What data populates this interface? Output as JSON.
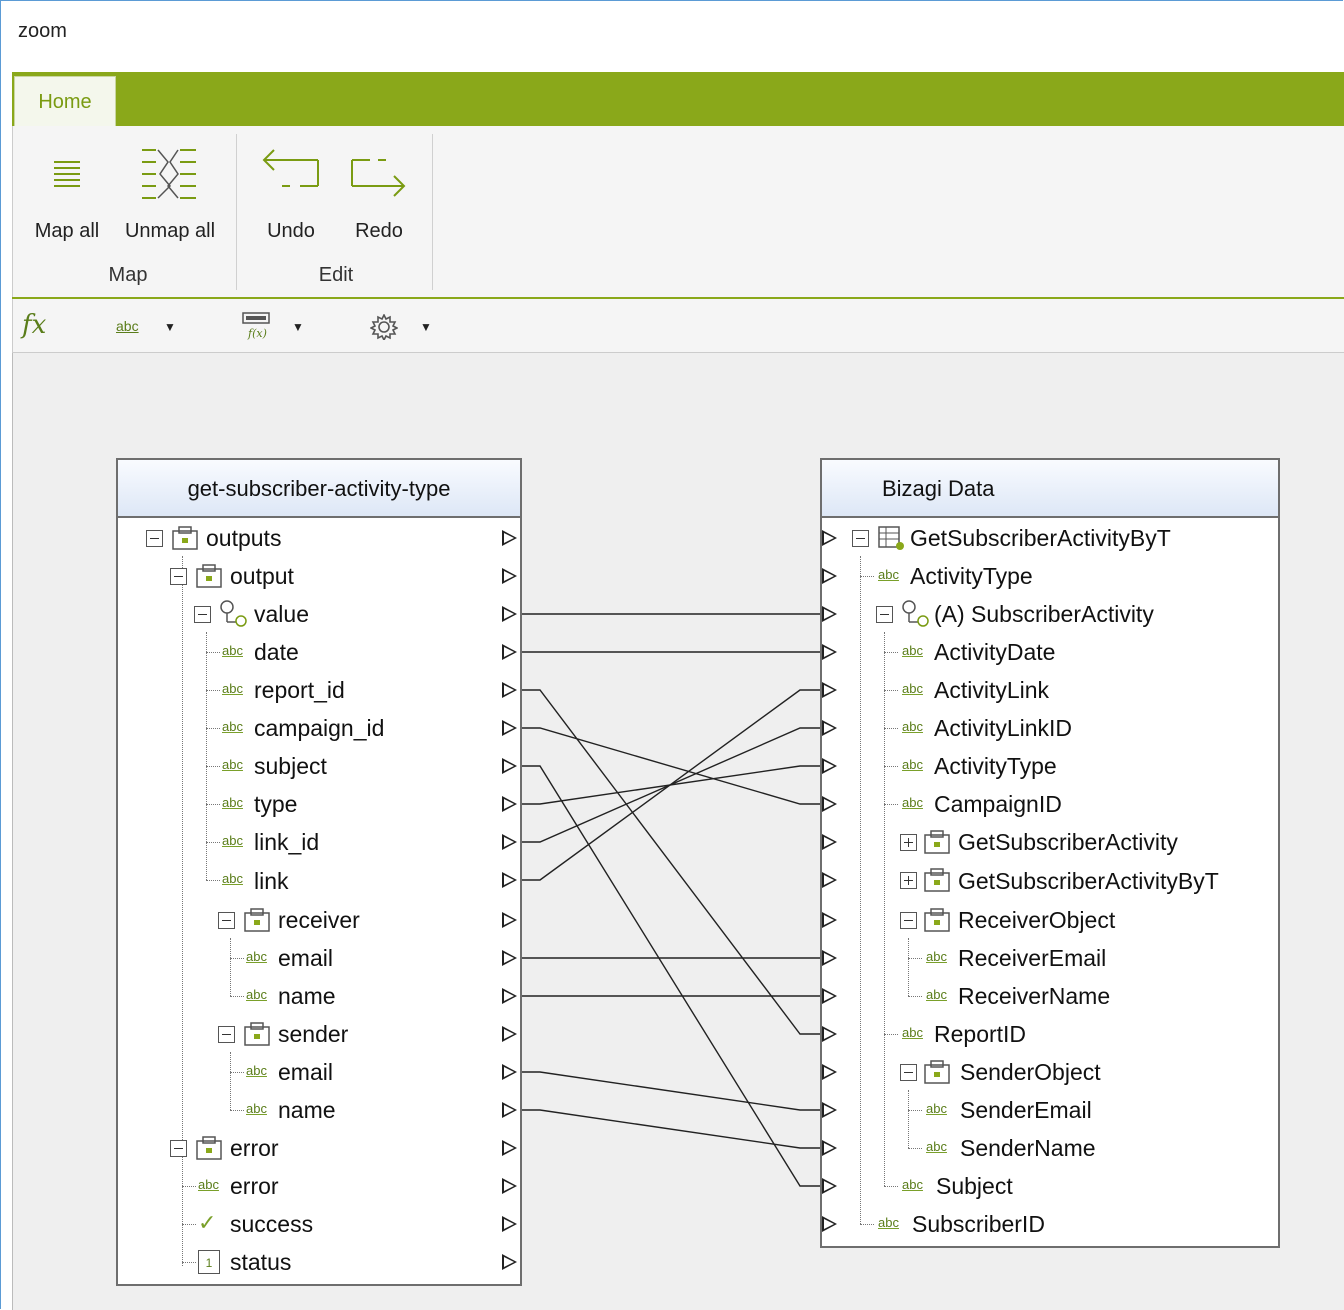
{
  "window": {
    "title": "zoom"
  },
  "ribbon": {
    "tabs": [
      {
        "label": "Home"
      }
    ],
    "groups": {
      "map": {
        "label": "Map",
        "map_all": "Map all",
        "unmap_all": "Unmap all"
      },
      "edit": {
        "label": "Edit",
        "undo": "Undo",
        "redo": "Redo"
      }
    }
  },
  "toolbar": {
    "fx": "fx",
    "abc": "abc"
  },
  "source": {
    "title": "get-subscriber-activity-type",
    "nodes": [
      {
        "label": "outputs"
      },
      {
        "label": "output"
      },
      {
        "label": "value"
      },
      {
        "label": "date"
      },
      {
        "label": "report_id"
      },
      {
        "label": "campaign_id"
      },
      {
        "label": "subject"
      },
      {
        "label": "type"
      },
      {
        "label": "link_id"
      },
      {
        "label": "link"
      },
      {
        "label": "receiver"
      },
      {
        "label": "email"
      },
      {
        "label": "name"
      },
      {
        "label": "sender"
      },
      {
        "label": "email"
      },
      {
        "label": "name"
      },
      {
        "label": "error"
      },
      {
        "label": "error"
      },
      {
        "label": "success"
      },
      {
        "label": "status",
        "badge": "1"
      }
    ]
  },
  "target": {
    "title": "Bizagi Data",
    "nodes": [
      {
        "label": "GetSubscriberActivityByT"
      },
      {
        "label": "ActivityType"
      },
      {
        "label": "(A) SubscriberActivity"
      },
      {
        "label": "ActivityDate"
      },
      {
        "label": "ActivityLink"
      },
      {
        "label": "ActivityLinkID"
      },
      {
        "label": "ActivityType"
      },
      {
        "label": "CampaignID"
      },
      {
        "label": "GetSubscriberActivity"
      },
      {
        "label": "GetSubscriberActivityByT"
      },
      {
        "label": "ReceiverObject"
      },
      {
        "label": "ReceiverEmail"
      },
      {
        "label": "ReceiverName"
      },
      {
        "label": "ReportID"
      },
      {
        "label": "SenderObject"
      },
      {
        "label": "SenderEmail"
      },
      {
        "label": "SenderName"
      },
      {
        "label": "Subject"
      },
      {
        "label": "SubscriberID"
      }
    ]
  },
  "mappings": [
    {
      "from": "value",
      "to": "(A) SubscriberActivity"
    },
    {
      "from": "date",
      "to": "ActivityDate"
    },
    {
      "from": "report_id",
      "to": "ReportID"
    },
    {
      "from": "campaign_id",
      "to": "CampaignID"
    },
    {
      "from": "subject",
      "to": "Subject"
    },
    {
      "from": "type",
      "to": "ActivityType"
    },
    {
      "from": "link_id",
      "to": "ActivityLinkID"
    },
    {
      "from": "link",
      "to": "ActivityLink"
    },
    {
      "from": "receiver.email",
      "to": "ReceiverEmail"
    },
    {
      "from": "receiver.name",
      "to": "ReceiverName"
    },
    {
      "from": "sender.email",
      "to": "SenderEmail"
    },
    {
      "from": "sender.name",
      "to": "SenderName"
    }
  ]
}
